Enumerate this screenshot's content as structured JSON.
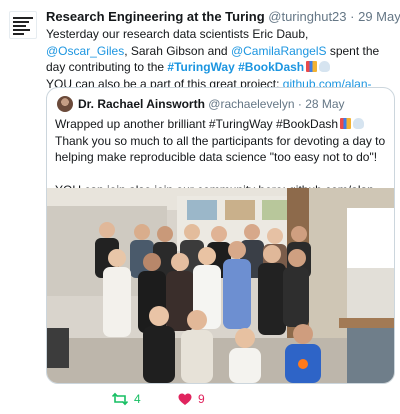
{
  "tweet": {
    "author": {
      "name": "Research Engineering at the Turing",
      "handle": "@turinghut23",
      "sep": "·",
      "date": "29 May"
    },
    "text": {
      "t1": "Yesterday our research data scientists Eric Daub, ",
      "m1": "@Oscar_Giles",
      "t2": ", Sarah Gibson and ",
      "m2": "@CamilaRangelS",
      "t3": " spent the day contributing to the ",
      "h1": "#TuringWay",
      "h2": "#BookDash",
      "t4": "YOU can also be a part of this great project: ",
      "link": "github.com/alan-turing-in…"
    },
    "emoji": [
      "books",
      "cloud"
    ]
  },
  "quoted": {
    "author": {
      "name": "Dr. Rachael Ainsworth",
      "handle": "@rachaelevelyn",
      "sep": "·",
      "date": "28 May"
    },
    "text": {
      "p1": "Wrapped up another brilliant #TuringWay #BookDash",
      "p1b": " Thank you so much to all the participants for devoting a day to helping make reproducible data science \"too easy not to do\"!",
      "p2": "YOU can join also join our community here: github.com/alan-turing-in…"
    },
    "photo": {
      "kind": "group-photo"
    }
  },
  "actions": {
    "retweets": "4",
    "likes": "9",
    "retweet_icon": "retweet-icon",
    "like_icon": "heart-icon"
  },
  "colors": {
    "link": "#1b95e0",
    "retweet": "#17bf63",
    "like": "#e0245e",
    "muted": "#657786"
  }
}
